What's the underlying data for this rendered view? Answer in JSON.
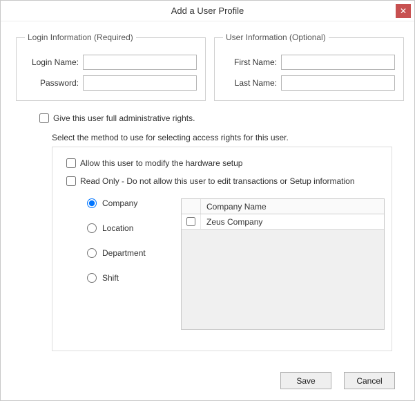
{
  "window": {
    "title": "Add a User Profile"
  },
  "login_group": {
    "legend": "Login Information (Required)",
    "login_name_label": "Login Name:",
    "login_name_value": "",
    "password_label": "Password:",
    "password_value": ""
  },
  "user_group": {
    "legend": "User Information (Optional)",
    "first_name_label": "First Name:",
    "first_name_value": "",
    "last_name_label": "Last Name:",
    "last_name_value": ""
  },
  "admin_checkbox": {
    "label": "Give this user full administrative rights.",
    "checked": false
  },
  "access": {
    "instruction": "Select the method to use for selecting access rights for this user.",
    "allow_modify": {
      "label": "Allow this user to modify the hardware setup",
      "checked": false
    },
    "read_only": {
      "label": "Read Only - Do not allow this user to edit transactions or Setup information",
      "checked": false
    },
    "radios": {
      "selected": "company",
      "company": "Company",
      "location": "Location",
      "department": "Department",
      "shift": "Shift"
    },
    "grid": {
      "header": "Company Name",
      "rows": [
        {
          "checked": false,
          "name": "Zeus Company"
        }
      ]
    }
  },
  "buttons": {
    "save": "Save",
    "cancel": "Cancel"
  }
}
